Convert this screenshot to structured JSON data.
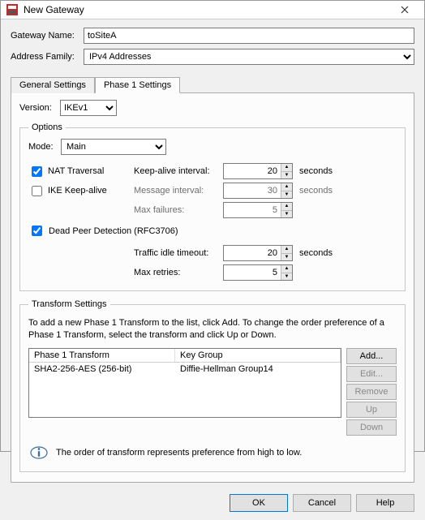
{
  "window": {
    "title": "New Gateway"
  },
  "header": {
    "gateway_name_label": "Gateway Name:",
    "gateway_name_value": "toSiteA",
    "address_family_label": "Address Family:",
    "address_family_value": "IPv4 Addresses"
  },
  "tabs": {
    "general": "General Settings",
    "phase1": "Phase 1 Settings"
  },
  "phase1": {
    "version_label": "Version:",
    "version_value": "IKEv1",
    "options_legend": "Options",
    "mode_label": "Mode:",
    "mode_value": "Main",
    "nat_traversal_label": "NAT Traversal",
    "nat_traversal_checked": true,
    "keep_alive_interval_label": "Keep-alive interval:",
    "keep_alive_interval_value": "20",
    "seconds_unit": "seconds",
    "ike_keep_alive_label": "IKE Keep-alive",
    "ike_keep_alive_checked": false,
    "message_interval_label": "Message interval:",
    "message_interval_value": "30",
    "max_failures_label": "Max failures:",
    "max_failures_value": "5",
    "dpd_label": "Dead Peer Detection (RFC3706)",
    "dpd_checked": true,
    "traffic_idle_timeout_label": "Traffic idle timeout:",
    "traffic_idle_timeout_value": "20",
    "max_retries_label": "Max retries:",
    "max_retries_value": "5"
  },
  "transform": {
    "legend": "Transform Settings",
    "description": "To add a new Phase 1 Transform to the list, click Add. To change the order preference of a Phase 1 Transform, select the transform and click Up or Down.",
    "col1": "Phase 1 Transform",
    "col2": "Key Group",
    "rows": [
      {
        "transform": "SHA2-256-AES (256-bit)",
        "key_group": "Diffie-Hellman Group14"
      }
    ],
    "buttons": {
      "add": "Add...",
      "edit": "Edit...",
      "remove": "Remove",
      "up": "Up",
      "down": "Down"
    },
    "info": "The order of transform represents preference from high to low."
  },
  "footer": {
    "ok": "OK",
    "cancel": "Cancel",
    "help": "Help"
  }
}
